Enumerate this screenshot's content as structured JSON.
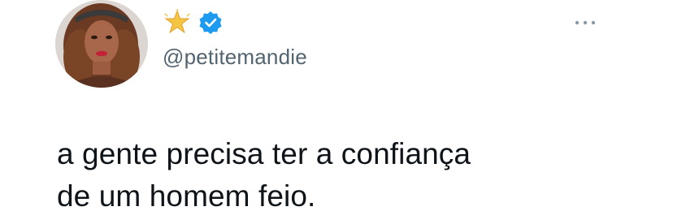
{
  "tweet": {
    "author": {
      "display_name_icons": [
        "star-emoji-icon",
        "verified-badge-icon"
      ],
      "handle": "@petitemandie"
    },
    "text_lines": [
      "a gente precisa ter a confiança",
      "de um homem feio."
    ],
    "more_icon": "more-options-icon"
  },
  "colors": {
    "verified": "#1d9bf0",
    "star": "#f4c542",
    "handle": "#536471",
    "text": "#0f1419"
  }
}
